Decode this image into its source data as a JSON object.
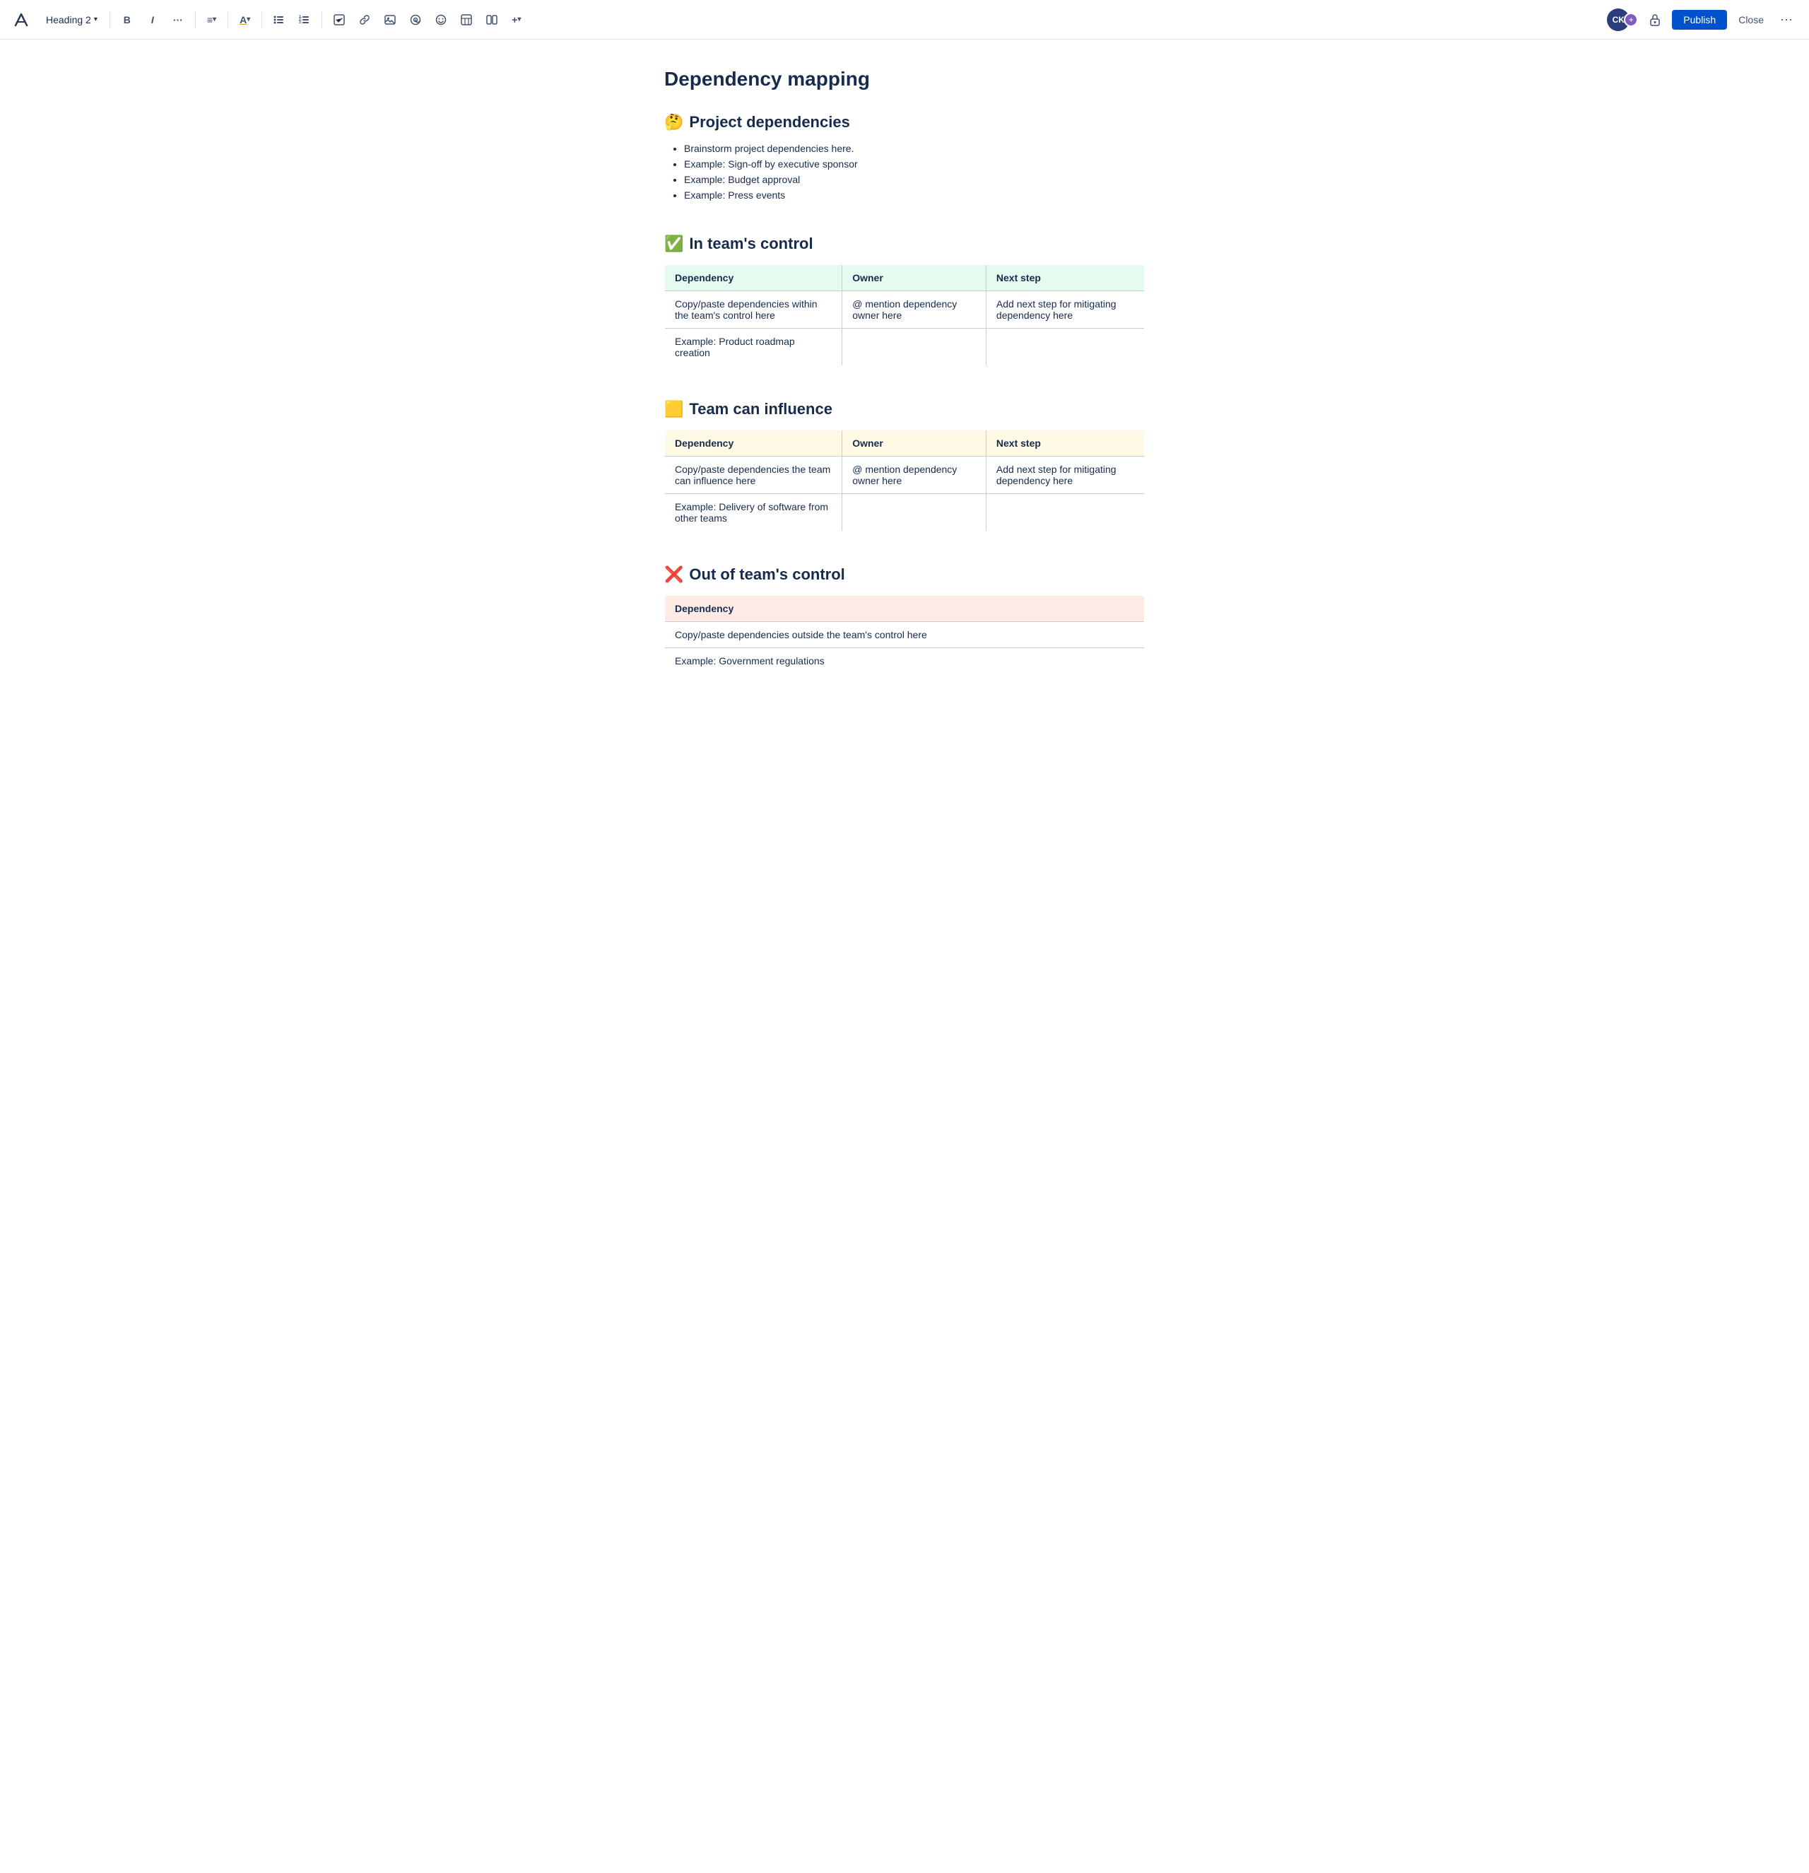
{
  "toolbar": {
    "logo_label": "✕",
    "heading_label": "Heading 2",
    "chevron": "▾",
    "bold": "B",
    "italic": "I",
    "more_format": "···",
    "align": "≡",
    "align_chevron": "▾",
    "text_color": "A",
    "color_chevron": "▾",
    "bullet_list": "•",
    "numbered_list": "1.",
    "task": "☑",
    "link": "🔗",
    "image": "🖼",
    "mention": "@",
    "emoji": "☺",
    "table": "⊞",
    "columns": "⫴",
    "insert": "+",
    "avatar_initials": "CK",
    "plus_label": "+",
    "lock": "🔒",
    "publish_label": "Publish",
    "close_label": "Close",
    "more": "···"
  },
  "page": {
    "title": "Dependency mapping"
  },
  "sections": [
    {
      "id": "project-dependencies",
      "icon": "🤔",
      "heading": "Project dependencies",
      "type": "bullets",
      "bullets": [
        "Brainstorm project dependencies here.",
        "Example: Sign-off by executive sponsor",
        "Example: Budget approval",
        "Example: Press events"
      ]
    },
    {
      "id": "in-team-control",
      "icon": "✅",
      "heading": "In team's control",
      "type": "table-3col",
      "table_style": "green",
      "columns": [
        "Dependency",
        "Owner",
        "Next step"
      ],
      "rows": [
        [
          "Copy/paste dependencies within the team's control here",
          "@ mention dependency owner here",
          "Add next step for mitigating dependency here"
        ],
        [
          "Example: Product roadmap creation",
          "",
          ""
        ]
      ]
    },
    {
      "id": "team-can-influence",
      "icon": "🟨",
      "heading": "Team can influence",
      "type": "table-3col",
      "table_style": "yellow",
      "columns": [
        "Dependency",
        "Owner",
        "Next step"
      ],
      "rows": [
        [
          "Copy/paste dependencies the team can influence here",
          "@ mention dependency owner here",
          "Add next step for mitigating dependency here"
        ],
        [
          "Example: Delivery of software from other teams",
          "",
          ""
        ]
      ]
    },
    {
      "id": "out-of-team-control",
      "icon": "❌",
      "heading": "Out of team's control",
      "type": "table-1col",
      "table_style": "pink",
      "columns": [
        "Dependency"
      ],
      "rows": [
        [
          "Copy/paste dependencies outside the team's control here"
        ],
        [
          "Example: Government regulations"
        ]
      ]
    }
  ]
}
